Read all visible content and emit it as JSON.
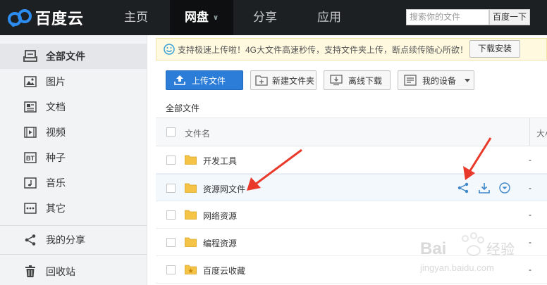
{
  "app": {
    "logo_text": "百度云"
  },
  "nav": {
    "items": [
      {
        "label": "主页",
        "active": false
      },
      {
        "label": "网盘",
        "active": true
      },
      {
        "label": "分享",
        "active": false
      },
      {
        "label": "应用",
        "active": false
      }
    ],
    "search_placeholder": "搜索你的文件",
    "search_button": "百度一下"
  },
  "sidebar": {
    "items": [
      {
        "label": "全部文件",
        "icon": "all-files-icon",
        "active": true
      },
      {
        "label": "图片",
        "icon": "image-icon"
      },
      {
        "label": "文档",
        "icon": "document-icon"
      },
      {
        "label": "视频",
        "icon": "video-icon"
      },
      {
        "label": "种子",
        "icon": "bt-icon",
        "icon_text": "BT"
      },
      {
        "label": "音乐",
        "icon": "music-icon"
      },
      {
        "label": "其它",
        "icon": "other-icon"
      },
      {
        "label": "我的分享",
        "icon": "share-icon"
      },
      {
        "label": "回收站",
        "icon": "trash-icon"
      }
    ]
  },
  "notice": {
    "text": "支持极速上传啦！4G大文件高速秒传，支持文件夹上传，断点续传随心所欲！",
    "button": "下载安装"
  },
  "toolbar": {
    "upload": "上传文件",
    "new_folder": "新建文件夹",
    "offline_download": "离线下载",
    "my_devices": "我的设备"
  },
  "breadcrumb": "全部文件",
  "table": {
    "header_name": "文件名",
    "header_size": "大小",
    "rows": [
      {
        "name": "开发工具",
        "size": "-",
        "type": "folder"
      },
      {
        "name": "资源网文件",
        "size": "-",
        "type": "folder",
        "hover": true
      },
      {
        "name": "网络资源",
        "size": "-",
        "type": "folder"
      },
      {
        "name": "编程资源",
        "size": "-",
        "type": "folder"
      },
      {
        "name": "百度云收藏",
        "size": "-",
        "type": "favorite-folder"
      }
    ]
  },
  "colors": {
    "topbar": "#1d2022",
    "primary": "#2b7dd7",
    "folder": "#f5c446",
    "arrow": "#e8392a"
  }
}
